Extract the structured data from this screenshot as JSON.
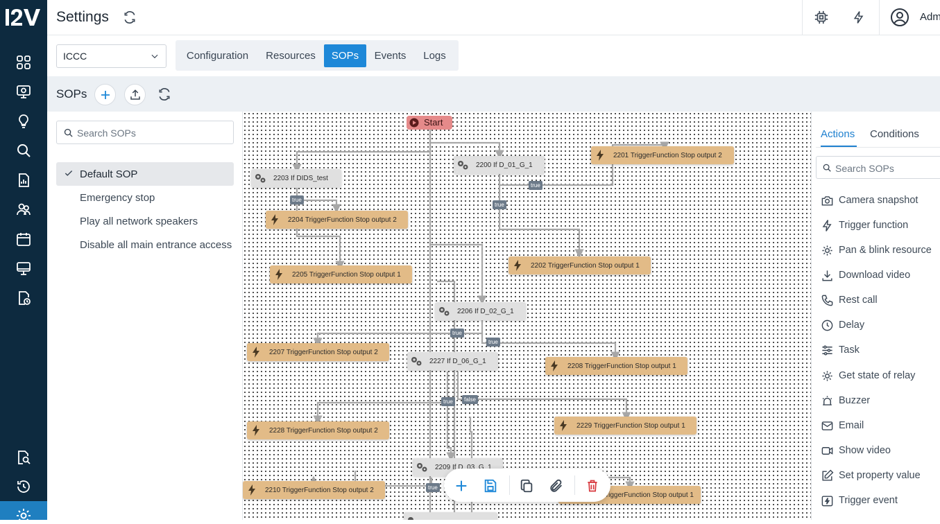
{
  "brand": {
    "logo_text": "I2V"
  },
  "header": {
    "title": "Settings",
    "user": "Adm"
  },
  "site_select": {
    "value": "ICCC"
  },
  "tabs": [
    {
      "label": "Configuration"
    },
    {
      "label": "Resources"
    },
    {
      "label": "SOPs",
      "active": true
    },
    {
      "label": "Events"
    },
    {
      "label": "Logs"
    }
  ],
  "sop_toolbar": {
    "heading": "SOPs"
  },
  "sop_search": {
    "placeholder": "Search SOPs"
  },
  "sop_list": [
    {
      "label": "Default SOP",
      "selected": true
    },
    {
      "label": "Emergency stop"
    },
    {
      "label": "Play all network speakers"
    },
    {
      "label": "Disable all main entrance access"
    }
  ],
  "flow": {
    "start": "Start",
    "nodes": [
      {
        "id": "n2201",
        "kind": "trigger",
        "label": "2201 TriggerFunction Stop output 2"
      },
      {
        "id": "n2200",
        "kind": "condition",
        "label": "2200 If D_01_G_1"
      },
      {
        "id": "n2203",
        "kind": "condition",
        "label": "2203 If DIDS_test"
      },
      {
        "id": "n2204",
        "kind": "trigger",
        "label": "2204 TriggerFunction Stop output 2"
      },
      {
        "id": "n2202",
        "kind": "trigger",
        "label": "2202 TriggerFunction Stop output 1"
      },
      {
        "id": "n2205",
        "kind": "trigger",
        "label": "2205 TriggerFunction Stop output 1"
      },
      {
        "id": "n2206",
        "kind": "condition",
        "label": "2206 If D_02_G_1"
      },
      {
        "id": "n2207",
        "kind": "trigger",
        "label": "2207 TriggerFunction Stop output 2"
      },
      {
        "id": "n2227",
        "kind": "condition",
        "label": "2227 If D_06_G_1"
      },
      {
        "id": "n2208",
        "kind": "trigger",
        "label": "2208 TriggerFunction Stop output 1"
      },
      {
        "id": "n2228",
        "kind": "trigger",
        "label": "2228 TriggerFunction Stop output 2"
      },
      {
        "id": "n2229",
        "kind": "trigger",
        "label": "2229 TriggerFunction Stop output 1"
      },
      {
        "id": "n2209",
        "kind": "condition",
        "label": "2209 If D_03_G_1"
      },
      {
        "id": "n2210",
        "kind": "trigger",
        "label": "2210 TriggerFunction Stop output 2"
      },
      {
        "id": "n2211",
        "kind": "trigger",
        "label": "TriggerFunction Stop output 1"
      }
    ],
    "badges": {
      "true": "true",
      "false": "false"
    }
  },
  "right_panel": {
    "tabs": [
      {
        "label": "Actions",
        "active": true
      },
      {
        "label": "Conditions"
      }
    ],
    "search_placeholder": "Search SOPs",
    "actions": [
      {
        "label": "Camera snapshot",
        "icon": "camera-icon"
      },
      {
        "label": "Trigger function",
        "icon": "lightning-icon"
      },
      {
        "label": "Pan & blink resource",
        "icon": "gear-icon"
      },
      {
        "label": "Download video",
        "icon": "download-icon"
      },
      {
        "label": "Rest call",
        "icon": "phone-icon"
      },
      {
        "label": "Delay",
        "icon": "clock-icon"
      },
      {
        "label": "Task",
        "icon": "sliders-icon"
      },
      {
        "label": "Get state of relay",
        "icon": "gear-icon"
      },
      {
        "label": "Buzzer",
        "icon": "alarm-icon"
      },
      {
        "label": "Email",
        "icon": "mail-icon"
      },
      {
        "label": "Show video",
        "icon": "video-icon"
      },
      {
        "label": "Set property value",
        "icon": "edit-icon"
      },
      {
        "label": "Trigger event",
        "icon": "trigger-event-icon"
      }
    ]
  }
}
